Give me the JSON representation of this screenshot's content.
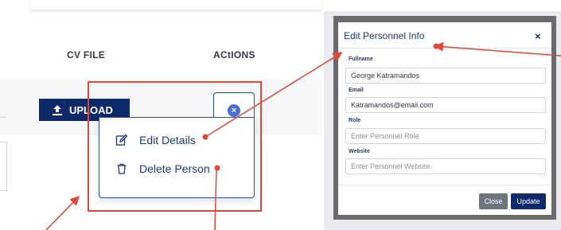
{
  "table": {
    "columns": [
      "CV FILE",
      "ACtIONS"
    ],
    "upload_label": "UPLOAD",
    "upload_icon": "upload-icon"
  },
  "actions_menu": {
    "close_icon": "close-icon",
    "close_glyph": "×",
    "items": [
      {
        "label": "Edit Details",
        "icon": "edit-icon"
      },
      {
        "label": "Delete Person",
        "icon": "trash-icon"
      }
    ]
  },
  "modal": {
    "title": "Edit Personnel Info",
    "close_glyph": "×",
    "fields": [
      {
        "label": "Fullname",
        "value": "George Katramandos",
        "placeholder": ""
      },
      {
        "label": "Email",
        "value": "Katramandos@email.com",
        "placeholder": ""
      },
      {
        "label": "Role",
        "value": "",
        "placeholder": "Enter Personnel Role"
      },
      {
        "label": "Website",
        "value": "",
        "placeholder": "Enter Personnel Website"
      }
    ],
    "close_button": "Close",
    "update_button": "Update"
  },
  "colors": {
    "brand_navy": "#0e2a6b",
    "annotation_red": "#e2473a",
    "menu_border": "#2f4f9d",
    "close_circle": "#4a6fd6",
    "secondary_button": "#6c757d"
  }
}
